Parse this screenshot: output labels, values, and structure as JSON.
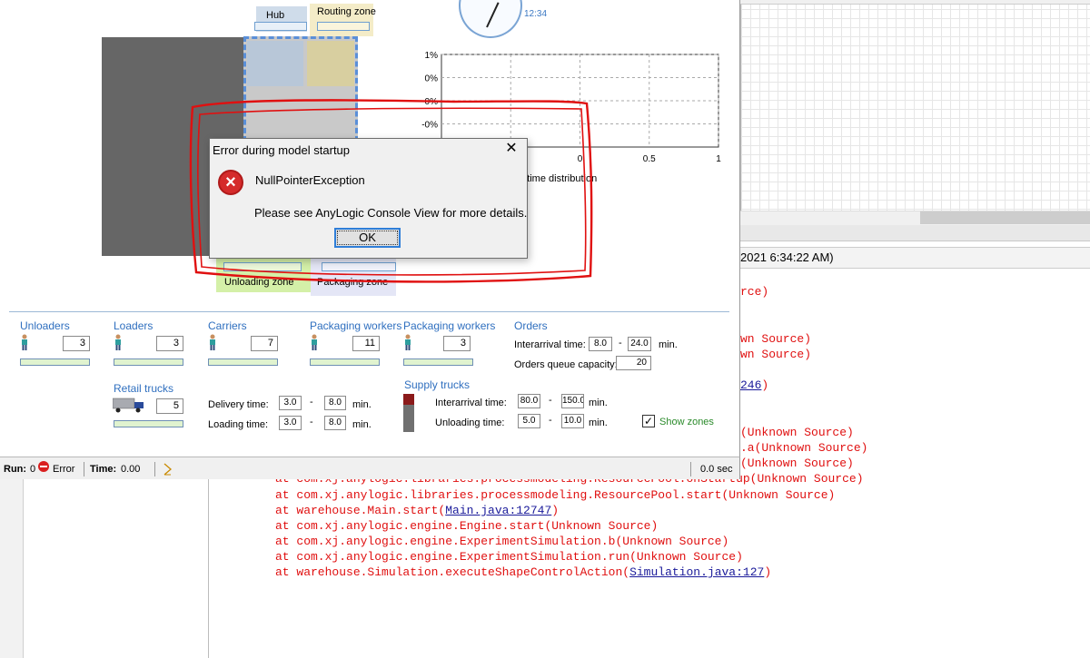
{
  "console": {
    "header_fragment": "2021 6:34:22 AM)",
    "lines": [
      {
        "pre": "rce)",
        "link": "",
        "post": ""
      },
      {
        "pre": "wn Source)",
        "link": "",
        "post": ""
      },
      {
        "pre": "wn Source)",
        "link": "",
        "post": ""
      },
      {
        "pre": "",
        "link": "246",
        "post": ")"
      },
      {
        "pre": "(Unknown Source)",
        "link": "",
        "post": ""
      },
      {
        "pre": ".a(Unknown Source)",
        "link": "",
        "post": ""
      },
      {
        "pre": "(Unknown Source)",
        "link": "",
        "post": ""
      },
      {
        "pre": "at com.xj.anylogic.libraries.processmodeling.ResourcePool.onStartup(Unknown Source)",
        "link": "",
        "post": ""
      },
      {
        "pre": "at com.xj.anylogic.libraries.processmodeling.ResourcePool.start(Unknown Source)",
        "link": "",
        "post": ""
      },
      {
        "pre": "at warehouse.Main.start(",
        "link": "Main.java:12747",
        "post": ")"
      },
      {
        "pre": "at com.xj.anylogic.engine.Engine.start(Unknown Source)",
        "link": "",
        "post": ""
      },
      {
        "pre": "at com.xj.anylogic.engine.ExperimentSimulation.b(Unknown Source)",
        "link": "",
        "post": ""
      },
      {
        "pre": "at com.xj.anylogic.engine.ExperimentSimulation.run(Unknown Source)",
        "link": "",
        "post": ""
      },
      {
        "pre": "at warehouse.Simulation.executeShapeControlAction(",
        "link": "Simulation.java:127",
        "post": ")"
      }
    ]
  },
  "model": {
    "zones": {
      "hub": "Hub",
      "routing": "Routing zone",
      "unloading": "Unloading zone",
      "packaging": "Packaging zone"
    },
    "clock_time": "12:34",
    "chart_partial_label": "g time distribution"
  },
  "chart_data": {
    "type": "line",
    "title": "",
    "xlabel": "g time distribution",
    "ylabel": "",
    "y_tick_labels": [
      "1%",
      "0%",
      "-0%",
      "-0%"
    ],
    "x_tick_labels": [
      "0",
      "0.5",
      "1"
    ],
    "xlim": [
      -1,
      1
    ],
    "grid": true,
    "series": []
  },
  "resources": {
    "unloaders": {
      "label": "Unloaders",
      "value": "3"
    },
    "loaders": {
      "label": "Loaders",
      "value": "3"
    },
    "carriers": {
      "label": "Carriers",
      "value": "7"
    },
    "packaging1": {
      "label": "Packaging workers",
      "value": "11"
    },
    "packaging2": {
      "label": "Packaging workers",
      "value": "3"
    },
    "retail_trucks": {
      "label": "Retail trucks",
      "value": "5"
    }
  },
  "orders": {
    "title": "Orders",
    "interarrival_label": "Interarrival time:",
    "interarrival_min": "8.0",
    "interarrival_max": "24.0",
    "unit": "min.",
    "queue_label": "Orders queue capacity:",
    "queue_value": "20"
  },
  "retail": {
    "delivery_label": "Delivery time:",
    "delivery_min": "3.0",
    "delivery_max": "8.0",
    "loading_label": "Loading time:",
    "loading_min": "3.0",
    "loading_max": "8.0",
    "unit": "min."
  },
  "supply": {
    "title": "Supply trucks",
    "interarrival_label": "Interarrival time:",
    "interarrival_min": "80.0",
    "interarrival_max": "150.0",
    "unloading_label": "Unloading time:",
    "unloading_min": "5.0",
    "unloading_max": "10.0",
    "unit": "min."
  },
  "show_zones": {
    "label": "Show zones",
    "checked": "✓"
  },
  "status": {
    "run_label": "Run:",
    "run_value": "0",
    "error_label": "Error",
    "time_label": "Time:",
    "time_value": "0.00",
    "elapsed": "0.0 sec"
  },
  "dialog": {
    "title": "Error during model startup",
    "close": "✕",
    "exception": "NullPointerException",
    "details": "Please see AnyLogic Console View for more details.",
    "ok_label": "OK"
  },
  "colors": {
    "annotation": "#e01010",
    "accent": "#2f6fbf",
    "error": "#d91f1f"
  }
}
